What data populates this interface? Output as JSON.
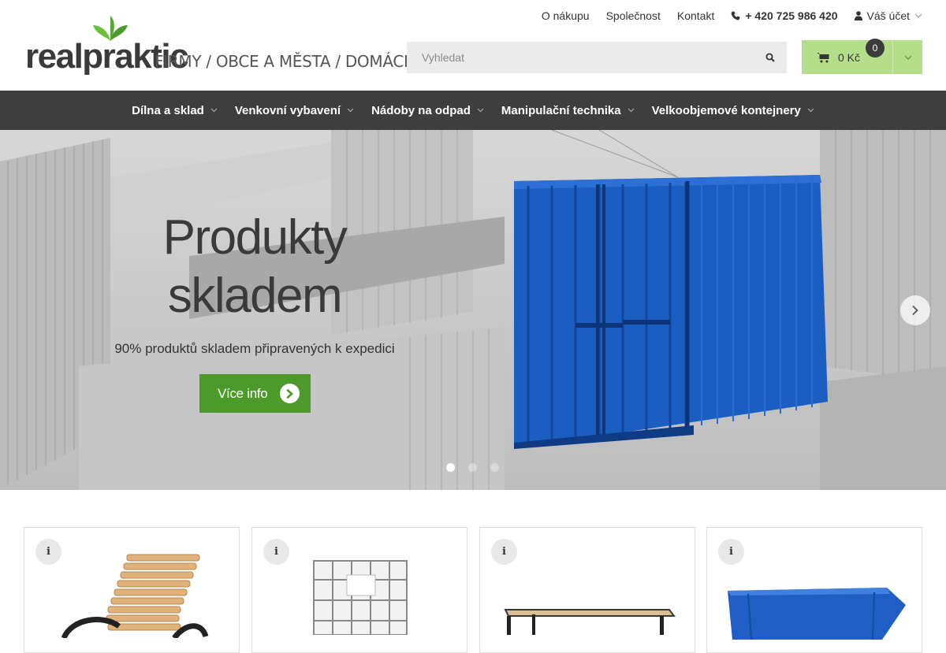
{
  "brand": {
    "name": "realpraktic",
    "tagline": "FIRMY / OBCE A MĚSTA / DOMÁCNOSTI",
    "leaf_color": "#5aa832"
  },
  "topnav": {
    "links": [
      "O nákupu",
      "Společnost",
      "Kontakt"
    ],
    "phone": "+ 420 725 986 420",
    "account": "Váš účet"
  },
  "search": {
    "placeholder": "Vyhledat"
  },
  "cart": {
    "total": "0 Kč",
    "count": "0",
    "color": "#b5de8a"
  },
  "mainnav": {
    "items": [
      "Dílna a sklad",
      "Venkovní vybavení",
      "Nádoby na odpad",
      "Manipulační technika",
      "Velkoobjemové kontejnery"
    ]
  },
  "hero": {
    "title_line1": "Produkty",
    "title_line2": "skladem",
    "subtitle": "90% produktů skladem připravených k expedici",
    "button_label": "Více info",
    "button_color": "#4c9b2a",
    "slides": 3,
    "active_slide": 1
  },
  "products": [
    {
      "info": "i",
      "image": "wooden-lounger"
    },
    {
      "info": "i",
      "image": "ibc-tank"
    },
    {
      "info": "i",
      "image": "work-table"
    },
    {
      "info": "i",
      "image": "tipping-skip"
    }
  ]
}
